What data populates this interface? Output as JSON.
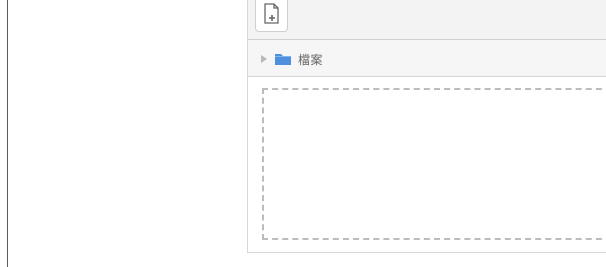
{
  "file_panel": {
    "toolbar": {
      "add_file_icon": "file-plus-icon"
    },
    "tree": {
      "expand_icon": "triangle-right-icon",
      "folder_icon": "folder-icon",
      "folder_label": "檔案"
    },
    "drop_zone": {
      "label": ""
    }
  },
  "colors": {
    "folder": "#4f8fdd",
    "folder_tab": "#7fb6ee",
    "border": "#d8d8d8",
    "dashed_border": "#bcbcbc",
    "left_rule": "#5f5b52"
  }
}
